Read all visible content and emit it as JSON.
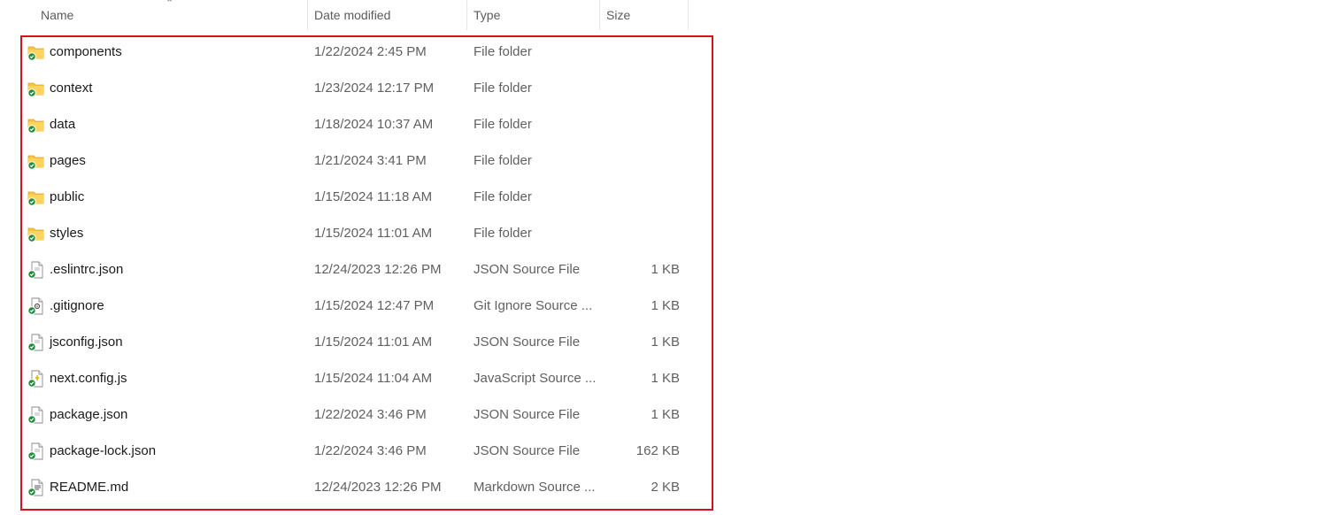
{
  "columns": {
    "name": "Name",
    "date_modified": "Date modified",
    "type": "Type",
    "size": "Size"
  },
  "sort": {
    "column": "Name",
    "direction": "ascending",
    "icon": "chevron-up-icon"
  },
  "colors": {
    "highlight": "#d6101c",
    "folder": "#f6c545",
    "sync_ok": "#1e8c3a"
  },
  "items": [
    {
      "name": "components",
      "date": "1/22/2024 2:45 PM",
      "type": "File folder",
      "size": "",
      "icon": "folder-icon"
    },
    {
      "name": "context",
      "date": "1/23/2024 12:17 PM",
      "type": "File folder",
      "size": "",
      "icon": "folder-icon"
    },
    {
      "name": "data",
      "date": "1/18/2024 10:37 AM",
      "type": "File folder",
      "size": "",
      "icon": "folder-icon"
    },
    {
      "name": "pages",
      "date": "1/21/2024 3:41 PM",
      "type": "File folder",
      "size": "",
      "icon": "folder-icon"
    },
    {
      "name": "public",
      "date": "1/15/2024 11:18 AM",
      "type": "File folder",
      "size": "",
      "icon": "folder-icon"
    },
    {
      "name": "styles",
      "date": "1/15/2024 11:01 AM",
      "type": "File folder",
      "size": "",
      "icon": "folder-icon"
    },
    {
      "name": ".eslintrc.json",
      "date": "12/24/2023 12:26 PM",
      "type": "JSON Source File",
      "size": "1 KB",
      "icon": "json-file-icon"
    },
    {
      "name": ".gitignore",
      "date": "1/15/2024 12:47 PM",
      "type": "Git Ignore Source ...",
      "size": "1 KB",
      "icon": "gitignore-file-icon"
    },
    {
      "name": "jsconfig.json",
      "date": "1/15/2024 11:01 AM",
      "type": "JSON Source File",
      "size": "1 KB",
      "icon": "json-file-icon"
    },
    {
      "name": "next.config.js",
      "date": "1/15/2024 11:04 AM",
      "type": "JavaScript Source ...",
      "size": "1 KB",
      "icon": "js-file-icon"
    },
    {
      "name": "package.json",
      "date": "1/22/2024 3:46 PM",
      "type": "JSON Source File",
      "size": "1 KB",
      "icon": "json-file-icon"
    },
    {
      "name": "package-lock.json",
      "date": "1/22/2024 3:46 PM",
      "type": "JSON Source File",
      "size": "162 KB",
      "icon": "json-file-icon"
    },
    {
      "name": "README.md",
      "date": "12/24/2023 12:26 PM",
      "type": "Markdown Source ...",
      "size": "2 KB",
      "icon": "markdown-file-icon"
    }
  ]
}
